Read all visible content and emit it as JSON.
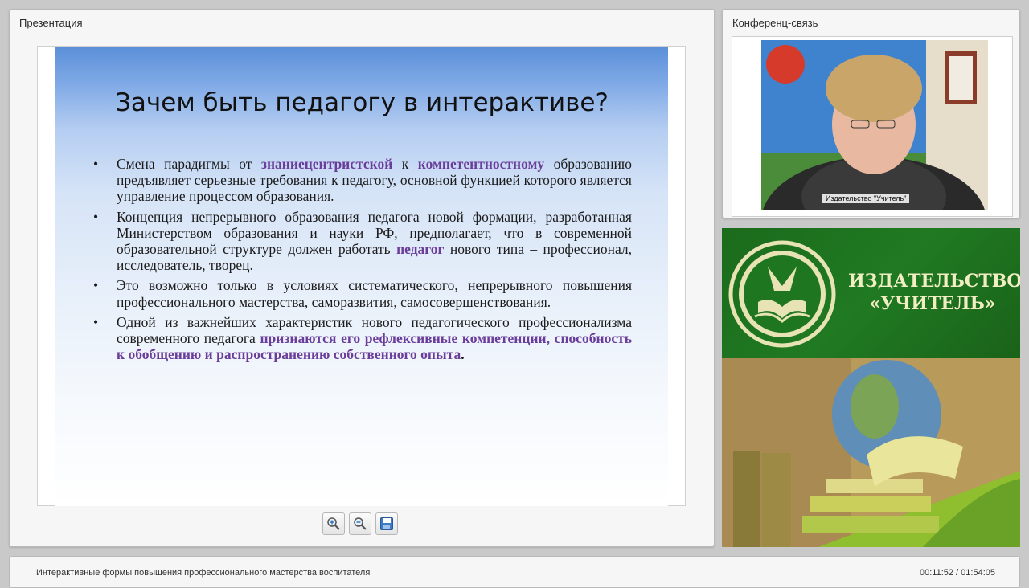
{
  "presentation": {
    "panel_title": "Презентация",
    "slide": {
      "title": "Зачем быть педагогу в интерактиве?",
      "bullets": [
        {
          "parts": [
            {
              "text": "Смена парадигмы от ",
              "hl": false
            },
            {
              "text": "знаниецентристской",
              "hl": true
            },
            {
              "text": " к ",
              "hl": false
            },
            {
              "text": "компетентностному",
              "hl": true
            },
            {
              "text": " образованию предъявляет серьезные требования к педагогу, основной функцией которого является управление процессом образования.",
              "hl": false
            }
          ]
        },
        {
          "parts": [
            {
              "text": " Концепция непрерывного образования педагога новой формации, разработанная Министерством образования и науки РФ, предполагает, что в современной образовательной структуре должен работать ",
              "hl": false
            },
            {
              "text": "педагог",
              "hl": true
            },
            {
              "text": " нового типа – профессионал, исследователь, творец.",
              "hl": false
            }
          ]
        },
        {
          "parts": [
            {
              "text": "Это возможно только в условиях систематического, непрерывного повышения профессионального мастерства, саморазвития, самосовершенствования.",
              "hl": false
            }
          ]
        },
        {
          "parts": [
            {
              "text": "Одной из важнейших характеристик нового педагогического профессионализма современного педагога ",
              "hl": false
            },
            {
              "text": "признаются его рефлексивные компетенции, способность к обобщению и распространению собственного опыта",
              "hl": true
            },
            {
              "text": ".",
              "hl": false,
              "bold": true
            }
          ]
        }
      ]
    },
    "toolbar": {
      "zoom_in_icon": "zoom-in-icon",
      "zoom_out_icon": "zoom-out-icon",
      "save_icon": "floppy-disk-icon"
    }
  },
  "conference": {
    "panel_title": "Конференц-связь",
    "video_label": "Издательство \"Учитель\""
  },
  "banner": {
    "publisher_line1": "ИЗДАТЕЛЬСТВО",
    "publisher_line2": "«УЧИТЕЛЬ»"
  },
  "footer": {
    "title": "Интерактивные формы повышения профессионального мастерства воспитателя",
    "time": "00:11:52 / 01:54:05"
  },
  "colors": {
    "highlight": "#6a3d9a",
    "banner_green": "#207a22",
    "banner_text": "#f2eec4"
  }
}
